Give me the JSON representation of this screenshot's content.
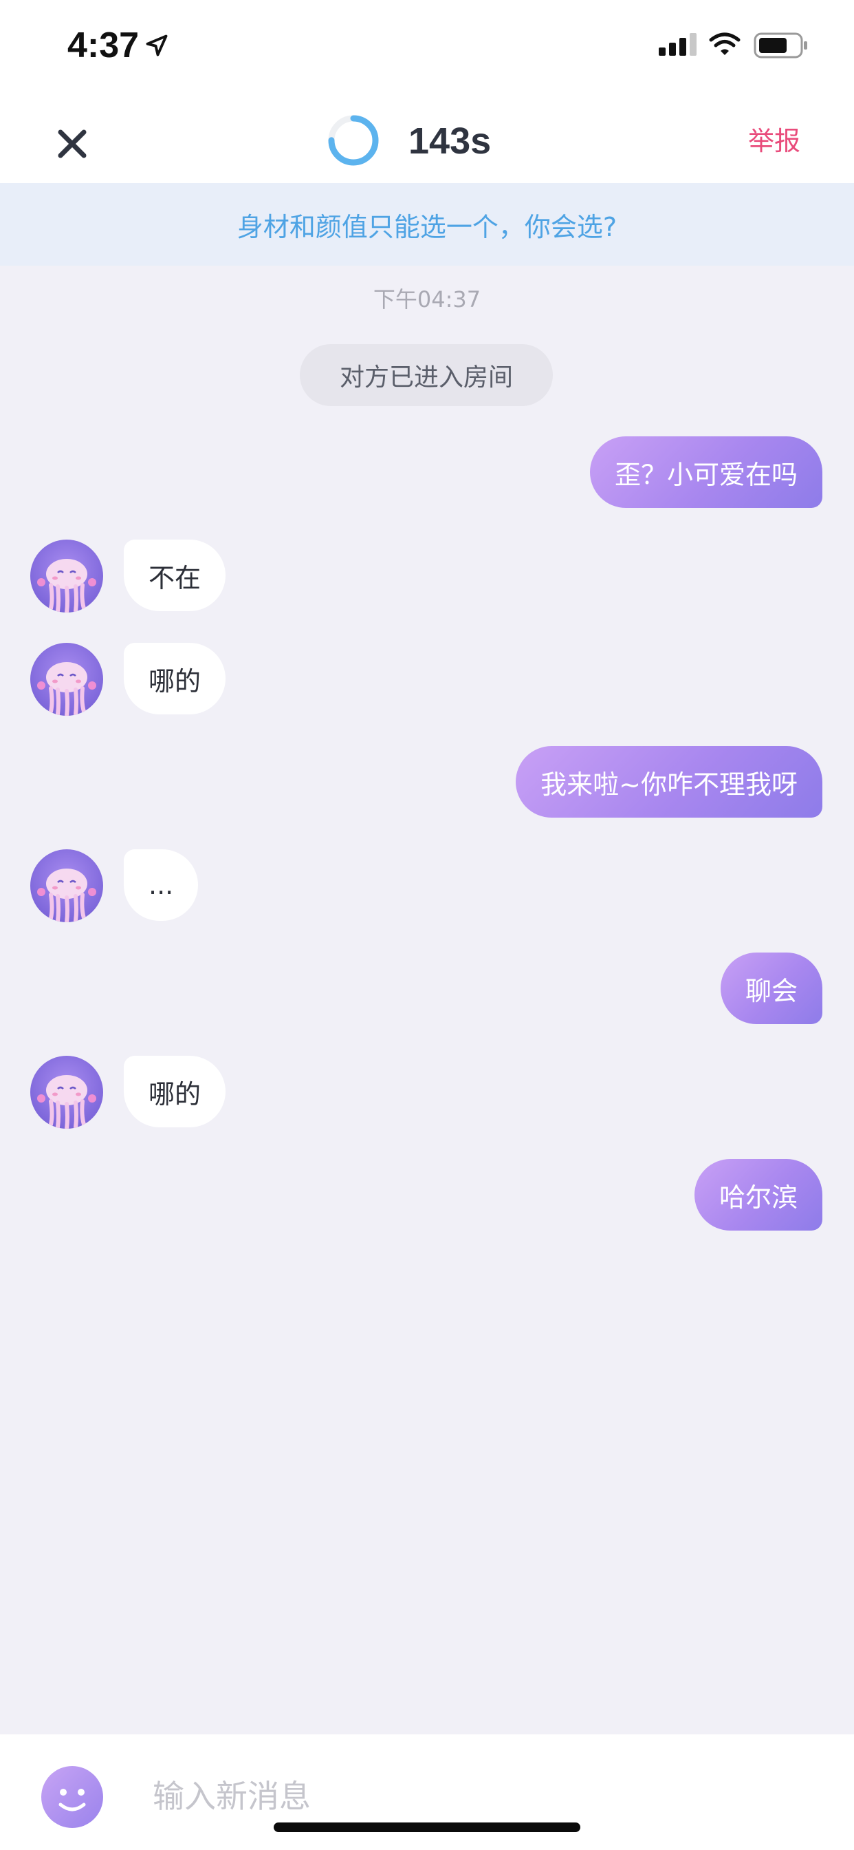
{
  "status_bar": {
    "time": "4:37",
    "icons": [
      "location-arrow-icon",
      "cellular-signal-icon",
      "wifi-icon",
      "battery-icon"
    ]
  },
  "header": {
    "close_icon": "close-icon",
    "timer_text": "143s",
    "timer_progress": 0.75,
    "report_label": "举报"
  },
  "topic": {
    "text": "身材和颜值只能选一个，你会选?"
  },
  "chat": {
    "timestamp": "下午04:37",
    "system_message": "对方已进入房间",
    "messages": [
      {
        "from": "me",
        "text": "歪？小可爱在吗"
      },
      {
        "from": "other",
        "text": "不在"
      },
      {
        "from": "other",
        "text": "哪的"
      },
      {
        "from": "me",
        "text": "我来啦~你咋不理我呀"
      },
      {
        "from": "other",
        "text": "..."
      },
      {
        "from": "me",
        "text": "聊会"
      },
      {
        "from": "other",
        "text": "哪的"
      },
      {
        "from": "me",
        "text": "哈尔滨"
      }
    ]
  },
  "input": {
    "placeholder": "输入新消息",
    "emoji_icon": "smiley-icon"
  },
  "colors": {
    "outgoing_bubble": "#a887ef",
    "topic_text": "#4ea3e4",
    "report": "#e94b7b",
    "timer_ring": "#5cb3ee",
    "background": "#f1f0f7"
  }
}
